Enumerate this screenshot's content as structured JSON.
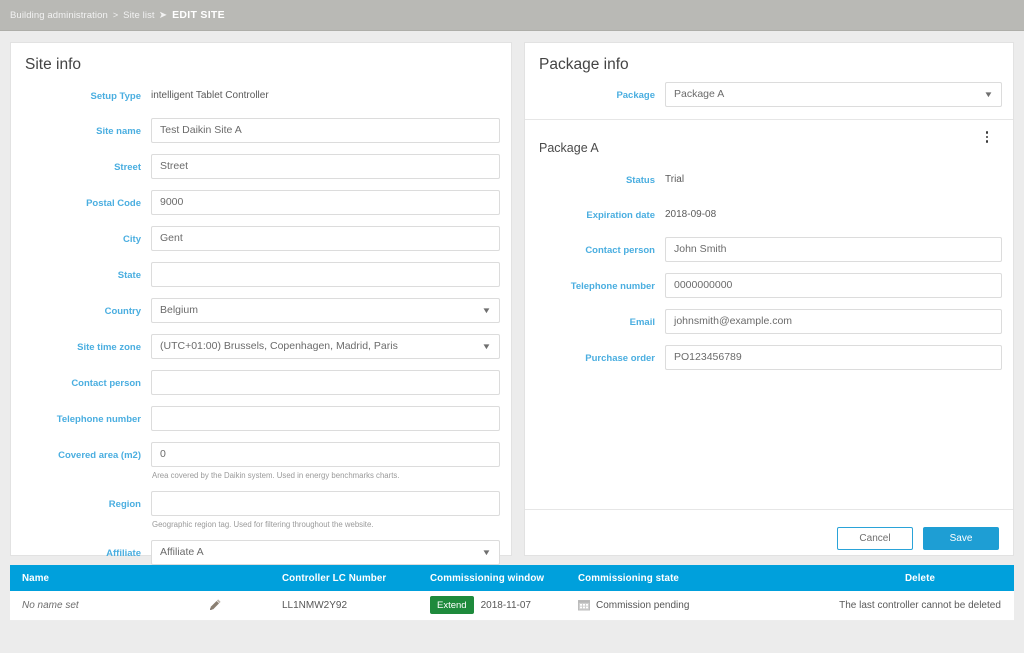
{
  "breadcrumb": {
    "root": "Building administration",
    "sep1": ">",
    "second": "Site list",
    "sep2": "➤",
    "current": "EDIT SITE"
  },
  "colors": {
    "label_blue": "#4aaee0",
    "table_header_blue": "#00a0dc",
    "primary_blue": "#1e9ed4",
    "extend_green": "#1e8a3c",
    "topbar_gray": "#b9b9b5",
    "page_bg": "#ececec"
  },
  "site_info": {
    "title": "Site info",
    "fields": [
      {
        "label": "Setup Type",
        "value": "intelligent Tablet Controller",
        "kind": "static"
      },
      {
        "label": "Site name",
        "value": "Test Daikin Site A",
        "kind": "input"
      },
      {
        "label": "Street",
        "value": "Street",
        "kind": "input"
      },
      {
        "label": "Postal Code",
        "value": "9000",
        "kind": "input"
      },
      {
        "label": "City",
        "value": "Gent",
        "kind": "input"
      },
      {
        "label": "State",
        "value": "",
        "kind": "input"
      },
      {
        "label": "Country",
        "value": "Belgium",
        "kind": "select"
      },
      {
        "label": "Site time zone",
        "value": "(UTC+01:00) Brussels, Copenhagen, Madrid, Paris",
        "kind": "select"
      },
      {
        "label": "Contact person",
        "value": "",
        "kind": "input"
      },
      {
        "label": "Telephone number",
        "value": "",
        "kind": "input"
      },
      {
        "label": "Covered area (m2)",
        "value": "0",
        "kind": "input",
        "help": "Area covered by the Daikin system. Used in energy benchmarks charts."
      },
      {
        "label": "Region",
        "value": "",
        "kind": "input",
        "help": "Geographic region tag. Used for filtering throughout the website."
      },
      {
        "label": "Affiliate",
        "value": "Affiliate A",
        "kind": "select"
      }
    ]
  },
  "package_info": {
    "title": "Package info",
    "package_label": "Package",
    "package_value": "Package A",
    "subtitle": "Package A",
    "menu_icon": "kebab-menu-icon",
    "fields": [
      {
        "label": "Status",
        "value": "Trial",
        "kind": "static"
      },
      {
        "label": "Expiration date",
        "value": "2018-09-08",
        "kind": "static"
      },
      {
        "label": "Contact person",
        "value": "John Smith",
        "kind": "input"
      },
      {
        "label": "Telephone number",
        "value": "0000000000",
        "kind": "input"
      },
      {
        "label": "Email",
        "value": "johnsmith@example.com",
        "kind": "input"
      },
      {
        "label": "Purchase order",
        "value": "PO123456789",
        "kind": "input"
      }
    ],
    "cancel_label": "Cancel",
    "save_label": "Save"
  },
  "controller_table": {
    "columns": [
      "Name",
      "Controller LC Number",
      "Commissioning window",
      "Commissioning state",
      "Delete"
    ],
    "rows": [
      {
        "name": "No name set",
        "edit_icon": "pencil-icon",
        "lc_number": "LL1NMW2Y92",
        "extend_label": "Extend",
        "window_date": "2018-11-07",
        "state_icon": "calendar-icon",
        "state": "Commission pending",
        "delete": "The last controller cannot be deleted"
      }
    ]
  }
}
